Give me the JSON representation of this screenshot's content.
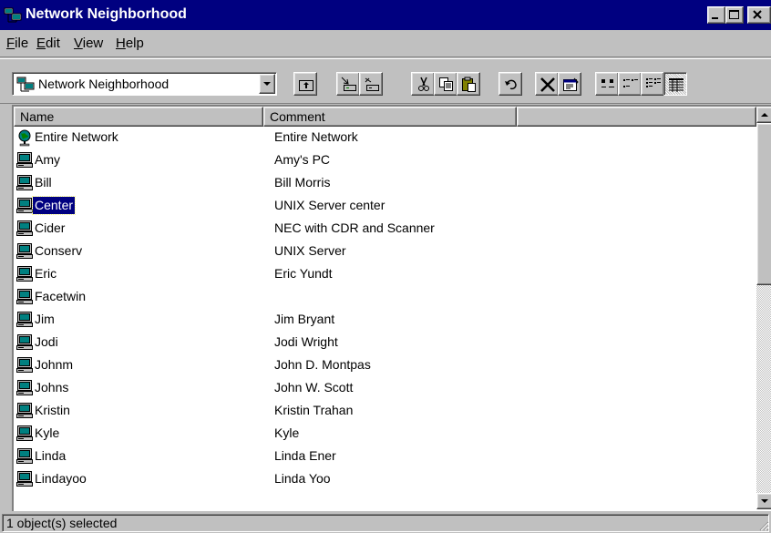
{
  "window": {
    "title": "Network Neighborhood",
    "icon": "network-neighborhood-icon"
  },
  "menu": {
    "items": [
      {
        "label": "File",
        "accel": "F",
        "rest": "ile"
      },
      {
        "label": "Edit",
        "accel": "E",
        "rest": "dit"
      },
      {
        "label": "View",
        "accel": "V",
        "rest": "iew"
      },
      {
        "label": "Help",
        "accel": "H",
        "rest": "elp"
      }
    ]
  },
  "toolbar": {
    "address_value": "Network Neighborhood",
    "buttons": [
      "up-one-level-icon",
      "map-network-drive-icon",
      "disconnect-network-drive-icon",
      "cut-icon",
      "copy-icon",
      "paste-icon",
      "undo-icon",
      "delete-icon",
      "properties-icon",
      "large-icons-icon",
      "small-icons-icon",
      "list-icon",
      "details-icon"
    ]
  },
  "list": {
    "columns": [
      "Name",
      "Comment",
      ""
    ],
    "rows": [
      {
        "name": "Entire Network",
        "comment": "Entire Network",
        "icon": "globe-icon"
      },
      {
        "name": "Amy",
        "comment": "Amy's PC",
        "icon": "computer-icon"
      },
      {
        "name": "Bill",
        "comment": "Bill Morris",
        "icon": "computer-icon"
      },
      {
        "name": "Center",
        "comment": "UNIX Server center",
        "icon": "computer-icon",
        "selected": true
      },
      {
        "name": "Cider",
        "comment": "NEC with CDR and Scanner",
        "icon": "computer-icon"
      },
      {
        "name": "Conserv",
        "comment": "UNIX Server",
        "icon": "computer-icon"
      },
      {
        "name": "Eric",
        "comment": "Eric Yundt",
        "icon": "computer-icon"
      },
      {
        "name": "Facetwin",
        "comment": "",
        "icon": "computer-icon"
      },
      {
        "name": "Jim",
        "comment": "Jim Bryant",
        "icon": "computer-icon"
      },
      {
        "name": "Jodi",
        "comment": "Jodi Wright",
        "icon": "computer-icon"
      },
      {
        "name": "Johnm",
        "comment": "John D. Montpas",
        "icon": "computer-icon"
      },
      {
        "name": "Johns",
        "comment": "John W. Scott",
        "icon": "computer-icon"
      },
      {
        "name": "Kristin",
        "comment": "Kristin Trahan",
        "icon": "computer-icon"
      },
      {
        "name": "Kyle",
        "comment": "Kyle",
        "icon": "computer-icon"
      },
      {
        "name": "Linda",
        "comment": "Linda Ener",
        "icon": "computer-icon"
      },
      {
        "name": "Lindayoo",
        "comment": "Linda Yoo",
        "icon": "computer-icon"
      }
    ]
  },
  "status": {
    "text": "1 object(s) selected"
  },
  "colors": {
    "titlebar": "#000080",
    "selection": "#000080",
    "face": "#c0c0c0"
  }
}
